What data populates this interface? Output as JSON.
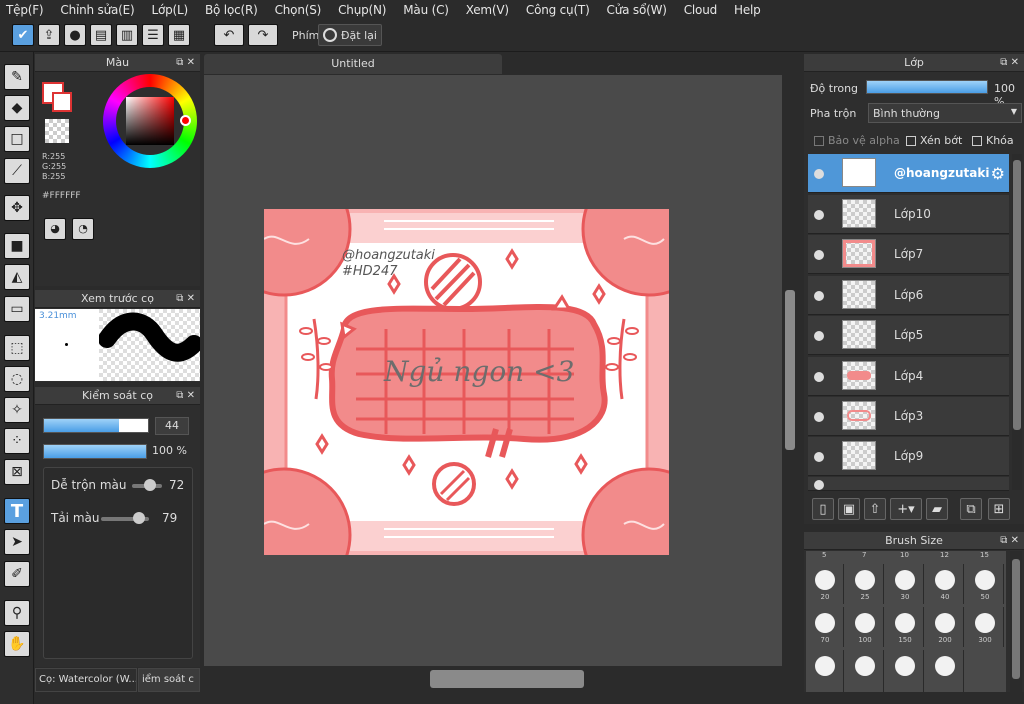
{
  "menu": [
    "Tệp(F)",
    "Chỉnh sửa(E)",
    "Lớp(L)",
    "Bộ lọc(R)",
    "Chọn(S)",
    "Chụp(N)",
    "Màu (C)",
    "Xem(V)",
    "Công cụ(T)",
    "Cửa sổ(W)",
    "Cloud",
    "Help"
  ],
  "toolbar": {
    "shortcut_label": "Phím",
    "reset_label": "Đặt lại"
  },
  "document": {
    "tab_title": "Untitled"
  },
  "color_panel": {
    "title": "Màu",
    "r": "R:255",
    "g": "G:255",
    "b": "B:255",
    "hex": "#FFFFFF"
  },
  "brush_preview": {
    "title": "Xem trước cọ",
    "size": "3.21mm"
  },
  "brush_control": {
    "title": "Kiểm soát cọ",
    "size_value": "44",
    "opacity_value": "100 %",
    "blend_label": "Dễ trộn màu",
    "blend_value": "72",
    "reload_label": "Tải màu",
    "reload_value": "79"
  },
  "bottom_tabs": [
    "Cọ: Watercolor (W...",
    "iểm soát c"
  ],
  "layers": {
    "title": "Lớp",
    "opacity_label": "Độ trong",
    "opacity_value": "100 %",
    "blend_label": "Pha trộn",
    "blend_mode": "Bình thường",
    "protect_alpha": "Bảo vệ alpha",
    "clipping": "Xén bớt",
    "lock": "Khóa",
    "items": [
      "@hoangzutaki",
      "Lớp10",
      "Lớp7",
      "Lớp6",
      "Lớp5",
      "Lớp4",
      "Lớp3",
      "Lớp9"
    ]
  },
  "brush_size": {
    "title": "Brush Size",
    "top_labels": [
      "5",
      "7",
      "10",
      "12",
      "15"
    ],
    "row1": [
      "20",
      "25",
      "30",
      "40",
      "50"
    ],
    "row2": [
      "70",
      "100",
      "150",
      "200",
      "300"
    ]
  },
  "artwork": {
    "handle": "@hoangzutaki",
    "tag": "#HD247",
    "title": "Ngủ ngon <3"
  },
  "colors": {
    "accent": "#5aa0e0",
    "art_pink": "#f28b8b",
    "art_red": "#e8585a"
  }
}
